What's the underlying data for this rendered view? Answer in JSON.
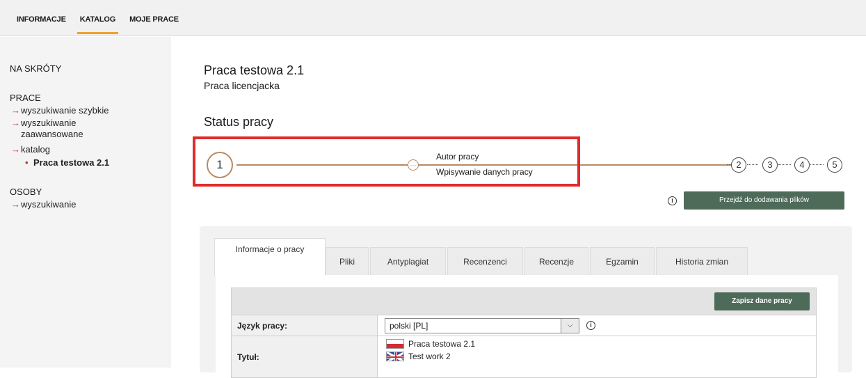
{
  "nav": {
    "items": [
      {
        "label": "INFORMACJE",
        "active": false
      },
      {
        "label": "KATALOG",
        "active": true
      },
      {
        "label": "MOJE PRACE",
        "active": false
      }
    ],
    "accent_color": "#f0a030"
  },
  "sidebar": {
    "shortcuts_heading": "NA SKRÓTY",
    "works_heading": "PRACE",
    "works_links": [
      "wyszukiwanie szybkie",
      "wyszukiwanie zaawansowane",
      "katalog"
    ],
    "current_item": "Praca testowa 2.1",
    "people_heading": "OSOBY",
    "people_links": [
      "wyszukiwanie"
    ]
  },
  "work": {
    "title": "Praca testowa 2.1",
    "type": "Praca licencjacka"
  },
  "status": {
    "heading": "Status pracy",
    "current_step": "1",
    "dot_symbol": "···",
    "step_title": "Autor pracy",
    "step_desc": "Wpisywanie danych pracy",
    "other_steps": [
      "2",
      "3",
      "4",
      "5"
    ],
    "highlight_color": "#e02b2b",
    "line_color": "#b98a62"
  },
  "actions": {
    "next_button": "Przejdź do dodawania plików",
    "save_button": "Zapisz dane pracy",
    "info_symbol": "i"
  },
  "tabs": [
    {
      "label": "Informacje o pracy",
      "active": true
    },
    {
      "label": "Pliki",
      "active": false
    },
    {
      "label": "Antyplagiat",
      "active": false
    },
    {
      "label": "Recenzenci",
      "active": false
    },
    {
      "label": "Recenzje",
      "active": false
    },
    {
      "label": "Egzamin",
      "active": false
    },
    {
      "label": "Historia zmian",
      "active": false
    }
  ],
  "form": {
    "language_label": "Język pracy:",
    "language_value": "polski [PL]",
    "title_label": "Tytuł:",
    "title_pl": "Praca testowa 2.1",
    "title_en": "Test work 2"
  }
}
